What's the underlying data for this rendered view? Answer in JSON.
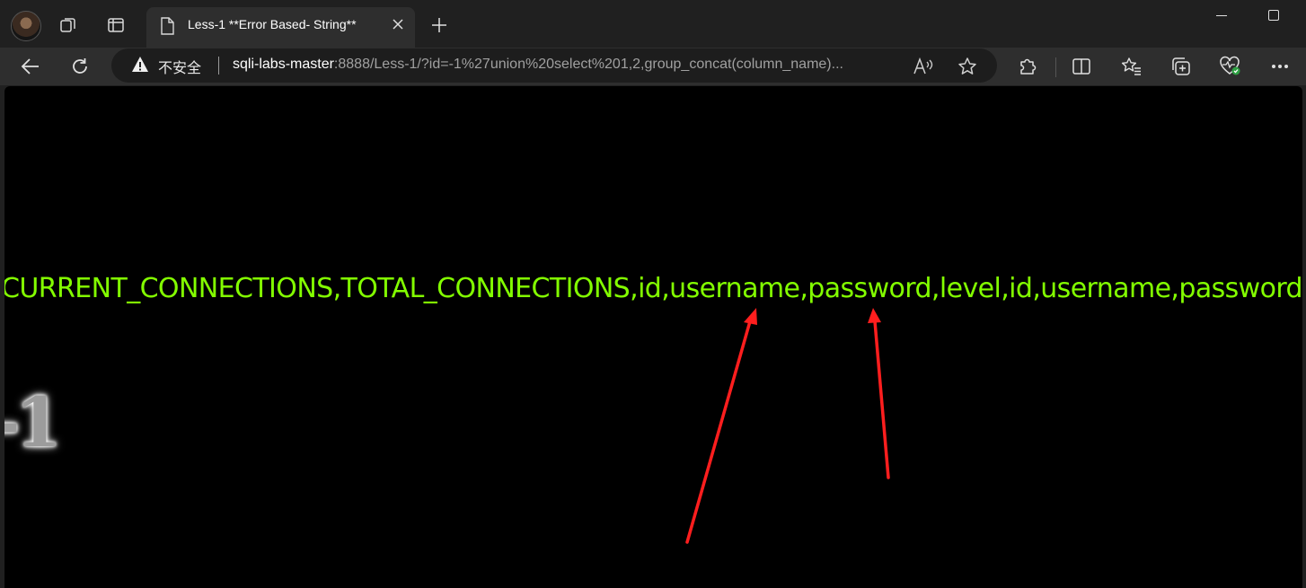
{
  "tab": {
    "title": "Less-1 **Error Based- String**"
  },
  "address": {
    "security_label": "不安全",
    "host": "sqli-labs-master",
    "rest": ":8888/Less-1/?id=-1%27union%20select%201,2,group_concat(column_name)..."
  },
  "page": {
    "result_text": "R,CURRENT_CONNECTIONS,TOTAL_CONNECTIONS,id,username,password,level,id,username,password",
    "logo_text": "-1"
  },
  "icons": [
    "avatar",
    "workspaces-icon",
    "tab-actions-icon",
    "page-icon",
    "close-icon",
    "new-tab-icon",
    "minimize-icon",
    "maximize-icon",
    "back-icon",
    "refresh-icon",
    "warning-icon",
    "read-aloud-icon",
    "favorite-icon",
    "extensions-icon",
    "split-screen-icon",
    "favorites-icon",
    "collections-icon",
    "browser-essentials-icon",
    "more-icon"
  ],
  "colors": {
    "result_text": "#83ff00",
    "annotation_arrow": "#ff1e1e"
  }
}
